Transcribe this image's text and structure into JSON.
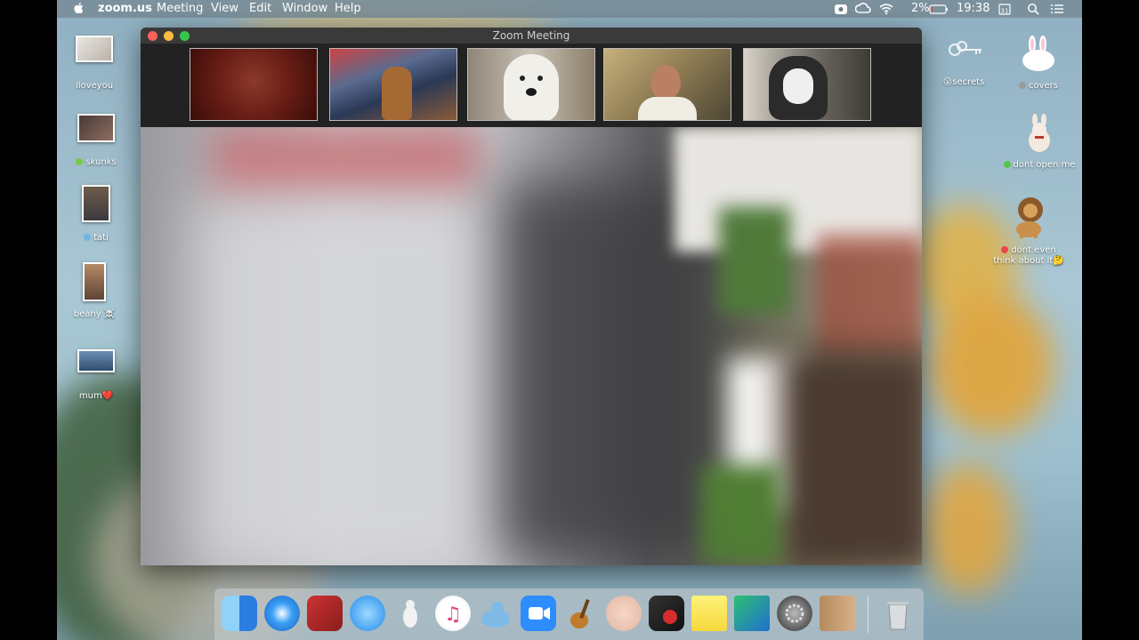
{
  "menubar": {
    "app_name": "zoom.us",
    "menus": [
      "Meeting",
      "View",
      "Edit",
      "Window",
      "Help"
    ],
    "battery": "2%",
    "time": "19:38"
  },
  "window": {
    "title": "Zoom Meeting"
  },
  "desktop_left": [
    {
      "label": "iloveyou"
    },
    {
      "label": "skunks",
      "dot_color": "#7ac943"
    },
    {
      "label": "tati",
      "dot_color": "#6fb6e8"
    },
    {
      "label": "beany ☠️"
    },
    {
      "label": "mum❤️"
    }
  ],
  "desktop_right": [
    {
      "label": "secrets",
      "prefix": "😮"
    },
    {
      "label": "covers",
      "dot_color": "#9a9a9a"
    },
    {
      "label": "dont open me",
      "dot_color": "#5cc24a"
    },
    {
      "label": "dont even think about it",
      "suffix": "🤔",
      "dot_color": "#e8464c"
    }
  ],
  "dock_icons": [
    "finder-icon",
    "safari-icon",
    "photo-booth-icon",
    "messages-icon",
    "voice-utility-icon",
    "itunes-icon",
    "seal-app-icon",
    "zoom-icon",
    "garageband-icon",
    "face-app-icon",
    "photo-app-icon",
    "stickies-icon",
    "preview-icon",
    "system-preferences-icon",
    "contacts-icon",
    "trash-icon"
  ]
}
